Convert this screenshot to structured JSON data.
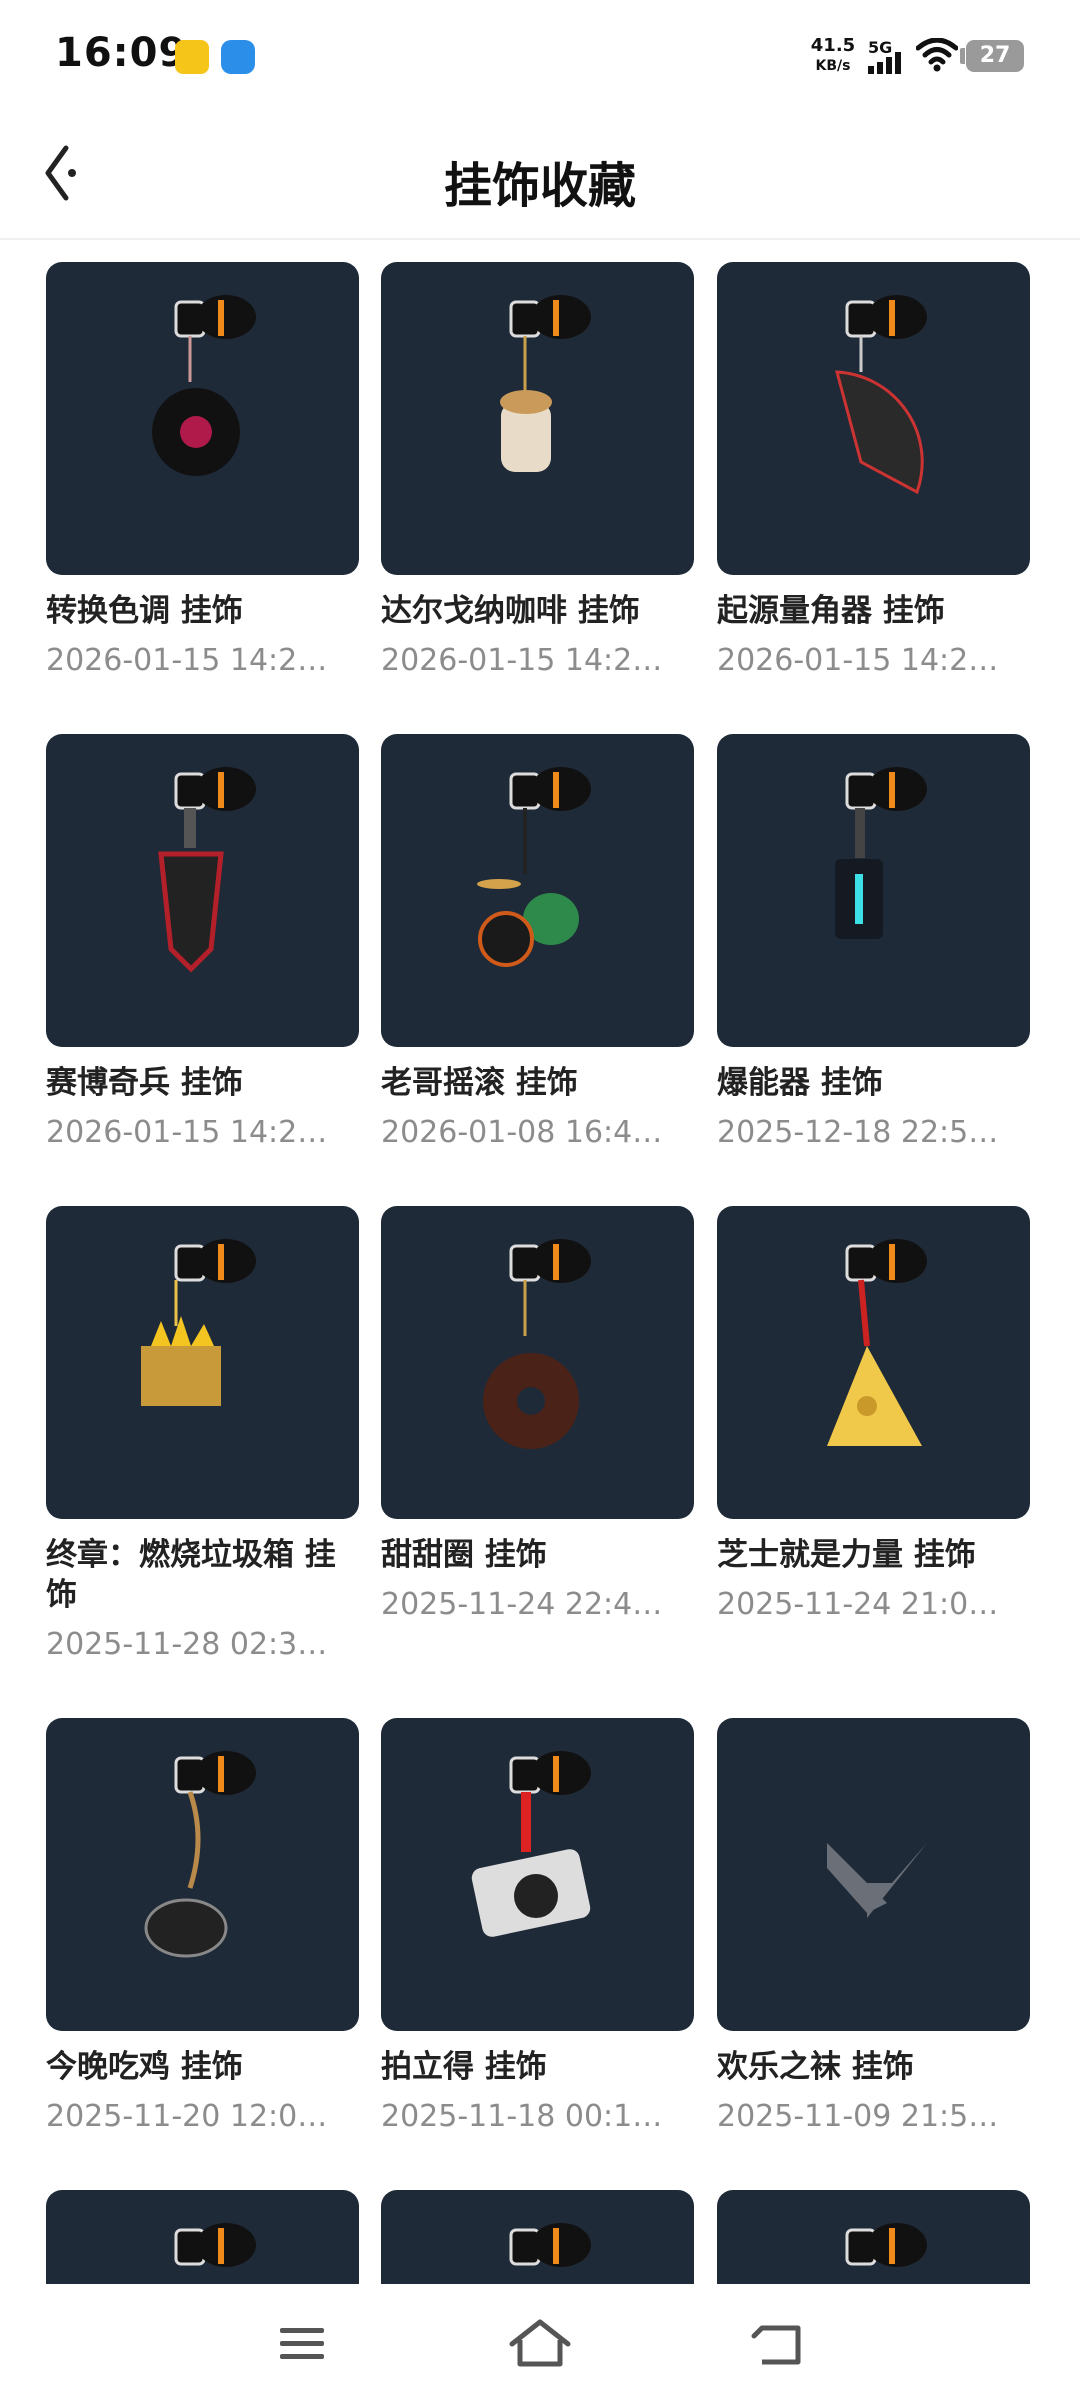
{
  "status_bar": {
    "time": "16:09",
    "net_speed_value": "41.5",
    "net_speed_unit": "KB/s",
    "network": "5G",
    "battery": "27"
  },
  "header": {
    "title": "挂饰收藏"
  },
  "items": [
    {
      "title": "转换色调 挂饰",
      "date": "2026-01-15 14:2…",
      "icon": "vinyl-record-charm"
    },
    {
      "title": "达尔戈纳咖啡 挂饰",
      "date": "2026-01-15 14:2…",
      "icon": "coffee-cup-charm"
    },
    {
      "title": "起源量角器 挂饰",
      "date": "2026-01-15 14:2…",
      "icon": "protractor-charm"
    },
    {
      "title": "赛博奇兵 挂饰",
      "date": "2026-01-15 14:2…",
      "icon": "cyber-tag-charm"
    },
    {
      "title": "老哥摇滚 挂饰",
      "date": "2026-01-08 16:4…",
      "icon": "drum-kit-charm"
    },
    {
      "title": "爆能器 挂饰",
      "date": "2025-12-18 22:5…",
      "icon": "blaster-charm"
    },
    {
      "title": "终章：燃烧垃圾箱 挂饰",
      "date": "2025-11-28 02:3…",
      "icon": "burning-trash-box-charm"
    },
    {
      "title": "甜甜圈 挂饰",
      "date": "2025-11-24 22:4…",
      "icon": "donut-charm"
    },
    {
      "title": "芝士就是力量 挂饰",
      "date": "2025-11-24 21:0…",
      "icon": "cheese-charm"
    },
    {
      "title": "今晚吃鸡 挂饰",
      "date": "2025-11-20 12:0…",
      "icon": "chicken-charm"
    },
    {
      "title": "拍立得 挂饰",
      "date": "2025-11-18 00:1…",
      "icon": "camera-charm"
    },
    {
      "title": "欢乐之袜 挂饰",
      "date": "2025-11-09 21:5…",
      "icon": "valorant-logo-placeholder"
    },
    {
      "title": "",
      "date": "",
      "icon": "charm-partial"
    },
    {
      "title": "",
      "date": "",
      "icon": "charm-partial"
    },
    {
      "title": "",
      "date": "",
      "icon": "charm-partial"
    }
  ],
  "colors": {
    "thumb_bg": "#1f2a38",
    "accent_orange": "#f08a1a",
    "date_gray": "#8c8c8c"
  }
}
